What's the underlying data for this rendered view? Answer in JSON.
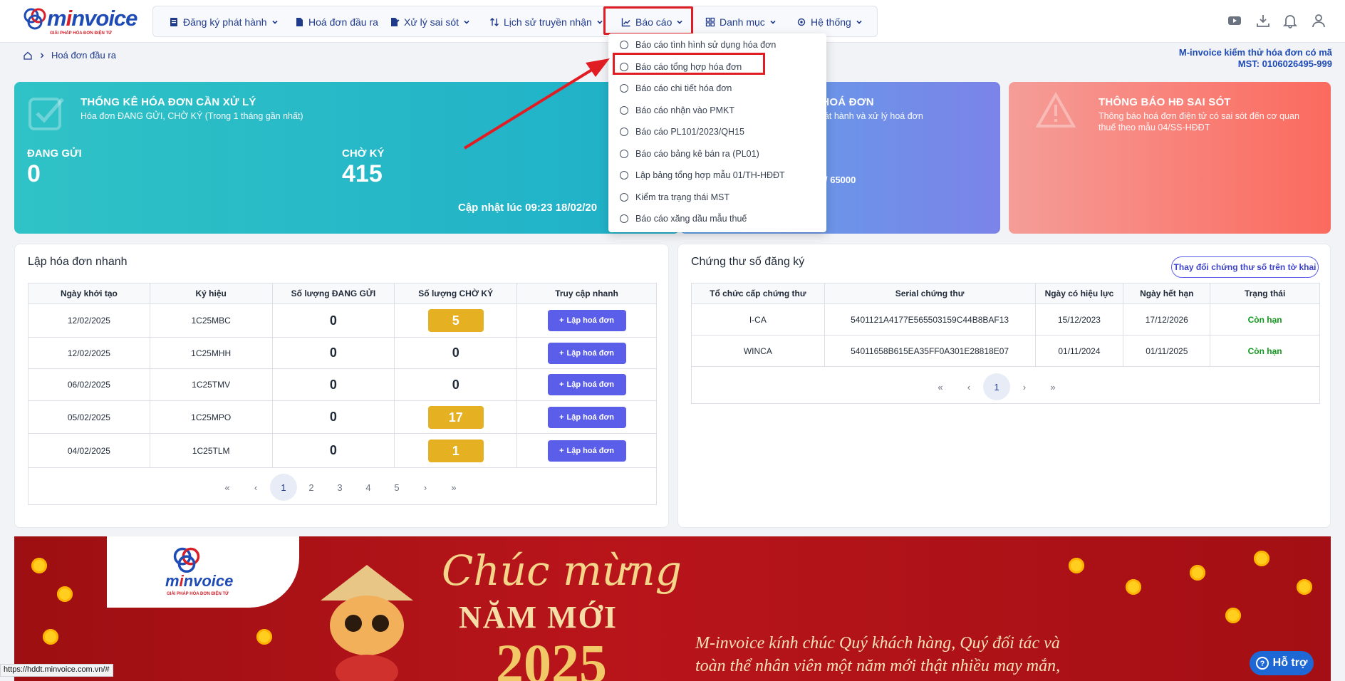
{
  "brand": {
    "name_pre": "m",
    "name_i": "i",
    "name_post": "nvoice",
    "tagline": "GIẢI PHÁP HÓA ĐƠN ĐIỆN TỬ"
  },
  "nav": {
    "items": [
      {
        "label": "Đăng ký phát hành",
        "icon": "document-icon"
      },
      {
        "label": "Hoá đơn đầu ra",
        "icon": "file-icon"
      },
      {
        "label": "Xử lý sai sót",
        "icon": "edit-file-icon"
      },
      {
        "label": "Lịch sử truyền nhận",
        "icon": "transfer-icon"
      },
      {
        "label": "Báo cáo",
        "icon": "chart-icon"
      },
      {
        "label": "Danh mục",
        "icon": "grid-icon"
      },
      {
        "label": "Hệ thống",
        "icon": "gear-icon"
      }
    ]
  },
  "breadcrumb": {
    "current": "Hoá đơn đầu ra"
  },
  "company": {
    "name": "M-invoice kiểm thử hóa đơn có mã",
    "mst": "MST: 0106026495-999"
  },
  "dropdown": {
    "items": [
      "Báo cáo tình hình sử dụng hóa đơn",
      "Báo cáo tổng hợp hóa đơn",
      "Báo cáo chi tiết hóa đơn",
      "Báo cáo nhận vào PMKT",
      "Báo cáo PL101/2023/QH15",
      "Báo cáo bảng kê bán ra (PL01)",
      "Lập bảng tổng hợp mẫu 01/TH-HĐĐT",
      "Kiểm tra trạng thái MST",
      "Báo cáo xăng dầu mẫu thuế"
    ]
  },
  "stats": {
    "title": "THỐNG KÊ HÓA ĐƠN CẦN XỬ LÝ",
    "subtitle": "Hóa đơn ĐANG GỬI, CHỜ KÝ (Trong 1 tháng gần nhất)",
    "sending_label": "ĐANG GỬI",
    "sending_value": "0",
    "waiting_label": "CHỜ KÝ",
    "waiting_value": "415",
    "updated": "Cập nhật lúc 09:23 18/02/20"
  },
  "invoice_card": {
    "title": "H HOÁ ĐƠN",
    "subtitle": "hát hành và xử lý hoá đơn",
    "quota": "/ 65000"
  },
  "error_card": {
    "title": "THÔNG BÁO HĐ SAI SÓT",
    "subtitle_1": "Thông báo hoá đơn điện tử có sai sót đến cơ quan",
    "subtitle_2": "thuế theo mẫu 04/SS-HĐĐT"
  },
  "quick": {
    "title": "Lập hóa đơn nhanh",
    "headers": [
      "Ngày khởi tạo",
      "Ký hiệu",
      "Số lượng ĐANG GỬI",
      "Số lượng CHỜ KÝ",
      "Truy cập nhanh"
    ],
    "button_label": "Lập hoá đơn",
    "rows": [
      {
        "date": "12/02/2025",
        "code": "1C25MBC",
        "sending": "0",
        "waiting": "5",
        "badge": true
      },
      {
        "date": "12/02/2025",
        "code": "1C25MHH",
        "sending": "0",
        "waiting": "0",
        "badge": false
      },
      {
        "date": "06/02/2025",
        "code": "1C25TMV",
        "sending": "0",
        "waiting": "0",
        "badge": false
      },
      {
        "date": "05/02/2025",
        "code": "1C25MPO",
        "sending": "0",
        "waiting": "17",
        "badge": true
      },
      {
        "date": "04/02/2025",
        "code": "1C25TLM",
        "sending": "0",
        "waiting": "1",
        "badge": true
      }
    ],
    "pages": [
      "«",
      "‹",
      "1",
      "2",
      "3",
      "4",
      "5",
      "›",
      "»"
    ]
  },
  "certs": {
    "title": "Chứng thư số đăng ký",
    "change_button": "Thay đổi chứng thư số trên tờ khai",
    "headers": [
      "Tổ chức cấp chứng thư",
      "Serial chứng thư",
      "Ngày có hiệu lực",
      "Ngày hết hạn",
      "Trạng thái"
    ],
    "rows": [
      {
        "org": "I-CA",
        "serial": "5401121A4177E565503159C44B8BAF13",
        "from": "15/12/2023",
        "to": "17/12/2026",
        "status": "Còn hạn"
      },
      {
        "org": "WINCA",
        "serial": "54011658B615EA35FF0A301E28818E07",
        "from": "01/11/2024",
        "to": "01/11/2025",
        "status": "Còn hạn"
      }
    ],
    "pages": [
      "«",
      "‹",
      "1",
      "›",
      "»"
    ]
  },
  "banner": {
    "line1": "Chúc mừng",
    "line2": "NĂM MỚI",
    "year": "2025",
    "message_1": "M-invoice kính chúc Quý khách hàng, Quý đối tác và",
    "message_2": "toàn thể nhân viên một năm mới thật nhiều may mắn,"
  },
  "status_url": "https://hddt.minvoice.com.vn/#",
  "help_label": "Hỗ trợ",
  "colors": {
    "primary": "#1f3a8a",
    "accent": "#5b5ee9",
    "highlight": "#e11d24",
    "badge": "#e5b022"
  }
}
